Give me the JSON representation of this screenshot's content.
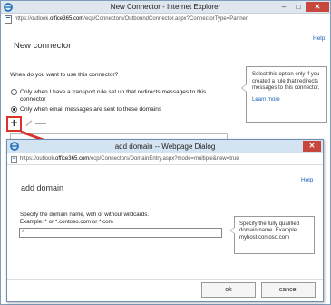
{
  "window": {
    "title": "New Connector - Internet Explorer",
    "url_prefix": "https://outlook.",
    "url_domain": "office365.com",
    "url_suffix": "/ecp/Connectors/OutboundConnector.aspx?ConnectorType=Partner",
    "controls": {
      "minimize": "–",
      "maximize": "□",
      "close": "✕"
    }
  },
  "page": {
    "help": "Help",
    "heading": "New connector",
    "question": "When do you want to use this connector?",
    "option1": "Only when I have a transport rule set up that redirects messages to this connector",
    "option2": "Only when email messages are sent to these domains",
    "option_selected": 2,
    "tooltip": "Select this option only if you created a rule that redirects messages to this connector.",
    "learn_more": "Learn more",
    "toolbar": {
      "add": "+",
      "remove": "—"
    }
  },
  "dialog": {
    "title": "add domain -- Webpage Dialog",
    "url_prefix": "https://outlook.",
    "url_domain": "office365.com",
    "url_suffix": "/ecp/Connectors/DomainEntry.aspx?mode=multiple&new=true",
    "close": "✕",
    "help": "Help",
    "heading": "add domain",
    "instruction_line1": "Specify the domain name, with or without wildcards.",
    "instruction_line2": "Example: * or *.contoso.com or *.com",
    "input_value": "*",
    "tooltip": "Specify the fully qualified domain name. Example: myhost.contoso.com",
    "ok": "ok",
    "cancel": "cancel"
  },
  "colors": {
    "accent": "#1a5fb4",
    "highlight": "#d9342b",
    "close": "#c7473d"
  }
}
